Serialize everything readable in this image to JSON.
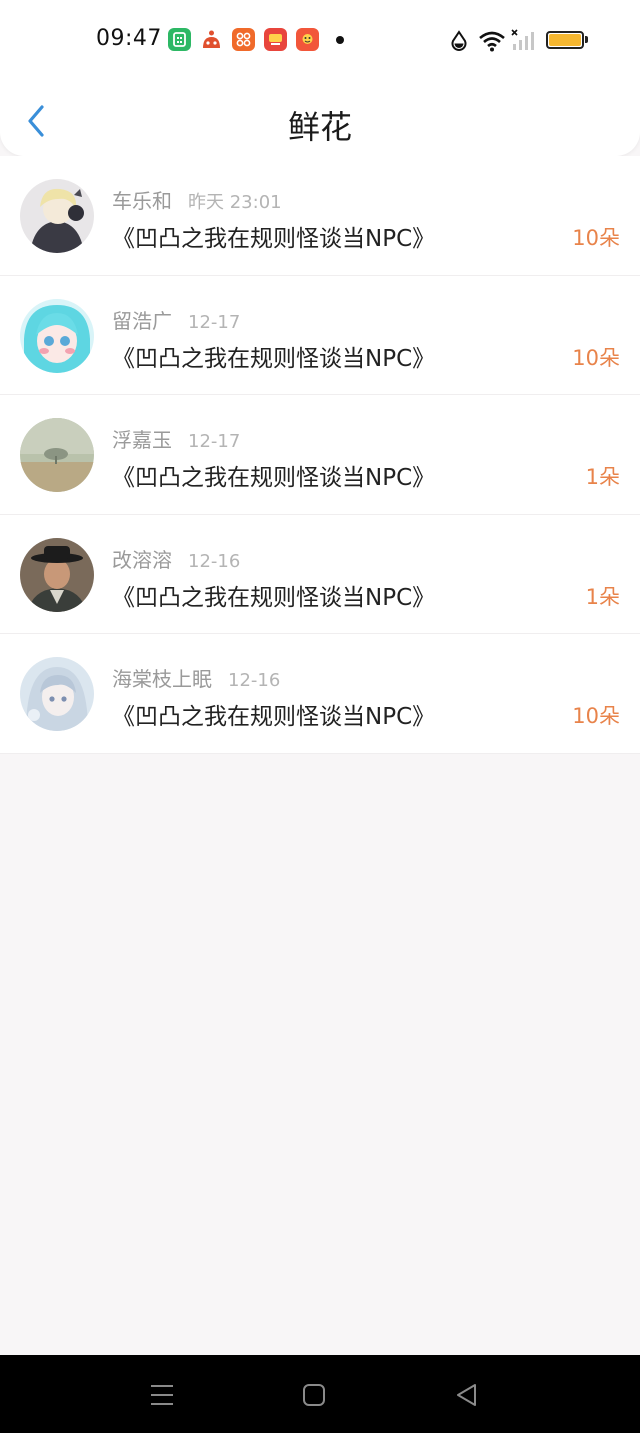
{
  "status_bar": {
    "time": "09:47",
    "apps": [
      {
        "icon": "green-app-icon",
        "color": "#2db865"
      },
      {
        "icon": "red-robot-app-icon",
        "color": "#e0502e"
      },
      {
        "icon": "orange-grid-app-icon",
        "color": "#f06a2a"
      },
      {
        "icon": "video-app-icon",
        "color": "#e8453c"
      },
      {
        "icon": "game-app-icon",
        "color": "#f2563a"
      }
    ],
    "battery_level": 1.0,
    "battery_color": "#f5b731"
  },
  "header": {
    "title": "鲜花",
    "back_icon": "chevron-left-icon",
    "accent": "#3a8fd9"
  },
  "gifts": [
    {
      "user": "车乐和",
      "date": "昨天 23:01",
      "book": "《凹凸之我在规则怪谈当NPC》",
      "amount": "10朵"
    },
    {
      "user": "留浩广",
      "date": "12-17",
      "book": "《凹凸之我在规则怪谈当NPC》",
      "amount": "10朵"
    },
    {
      "user": "浮嘉玉",
      "date": "12-17",
      "book": "《凹凸之我在规则怪谈当NPC》",
      "amount": "1朵"
    },
    {
      "user": "改溶溶",
      "date": "12-16",
      "book": "《凹凸之我在规则怪谈当NPC》",
      "amount": "1朵"
    },
    {
      "user": "海棠枝上眠",
      "date": "12-16",
      "book": "《凹凸之我在规则怪谈当NPC》",
      "amount": "10朵"
    }
  ],
  "colors": {
    "amount": "#e8834a",
    "name": "#9a9a9a",
    "background": "#f8f6f7"
  },
  "nav_bar": {
    "buttons": [
      "menu-icon",
      "home-icon",
      "back-triangle-icon"
    ]
  }
}
